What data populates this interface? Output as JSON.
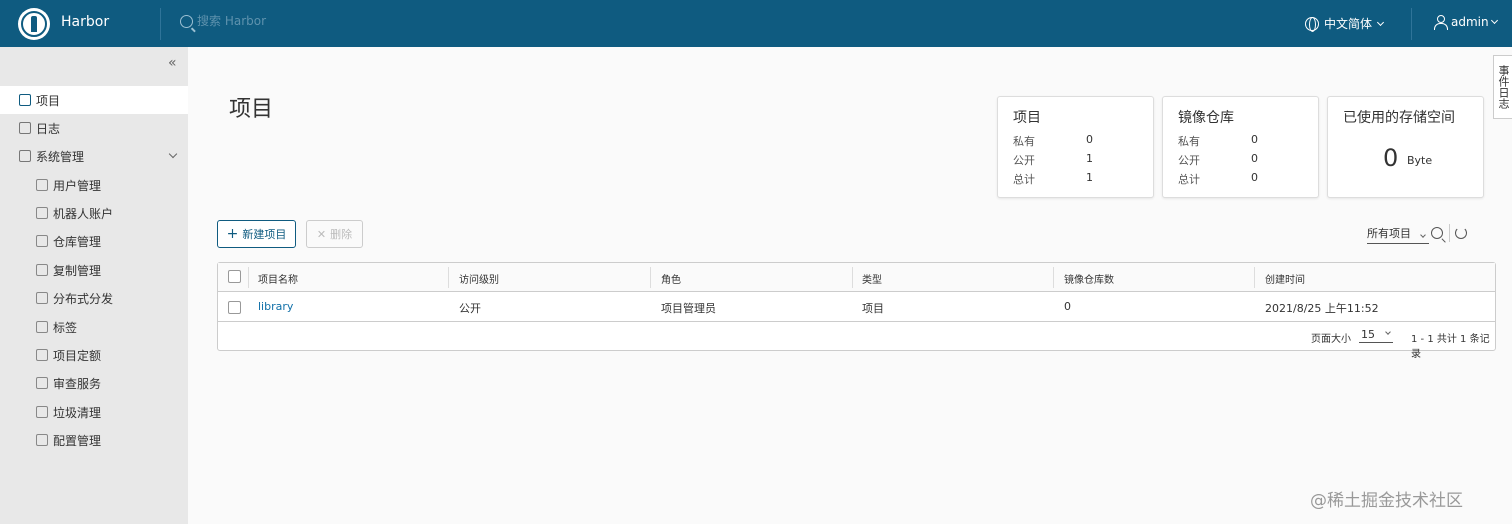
{
  "header": {
    "app_title": "Harbor",
    "search_placeholder": "搜索 Harbor",
    "language": "中文简体",
    "user": "admin"
  },
  "sidebar": {
    "items": [
      {
        "label": "项目",
        "icon": "projects-icon",
        "active": true
      },
      {
        "label": "日志",
        "icon": "log-icon"
      },
      {
        "label": "系统管理",
        "icon": "admin-icon"
      },
      {
        "label": "用户管理",
        "icon": "users-icon"
      },
      {
        "label": "机器人账户",
        "icon": "robot-icon"
      },
      {
        "label": "仓库管理",
        "icon": "registry-icon"
      },
      {
        "label": "复制管理",
        "icon": "replication-icon"
      },
      {
        "label": "分布式分发",
        "icon": "distribution-icon"
      },
      {
        "label": "标签",
        "icon": "tag-icon"
      },
      {
        "label": "项目定额",
        "icon": "quota-icon"
      },
      {
        "label": "审查服务",
        "icon": "shield-icon"
      },
      {
        "label": "垃圾清理",
        "icon": "trash-icon"
      },
      {
        "label": "配置管理",
        "icon": "gear-icon"
      }
    ]
  },
  "main": {
    "title": "项目",
    "cards": {
      "projects": {
        "title": "项目",
        "rows": [
          {
            "label": "私有",
            "value": "0"
          },
          {
            "label": "公开",
            "value": "1"
          },
          {
            "label": "总计",
            "value": "1"
          }
        ]
      },
      "repos": {
        "title": "镜像仓库",
        "rows": [
          {
            "label": "私有",
            "value": "0"
          },
          {
            "label": "公开",
            "value": "0"
          },
          {
            "label": "总计",
            "value": "0"
          }
        ]
      },
      "storage": {
        "title": "已使用的存储空间",
        "value": "0",
        "unit": "Byte"
      }
    },
    "new_project": "新建项目",
    "delete": "删除",
    "filter": "所有项目",
    "table": {
      "columns": [
        "项目名称",
        "访问级别",
        "角色",
        "类型",
        "镜像仓库数",
        "创建时间"
      ],
      "rows": [
        {
          "name": "library",
          "access": "公开",
          "role": "项目管理员",
          "type": "项目",
          "repo_count": "0",
          "created": "2021/8/25 上午11:52"
        }
      ],
      "page_size_label": "页面大小",
      "page_size": "15",
      "total": "1 - 1 共计 1 条记录"
    }
  },
  "event_tab": "事件日志",
  "watermark": "@稀土掘金技术社区"
}
